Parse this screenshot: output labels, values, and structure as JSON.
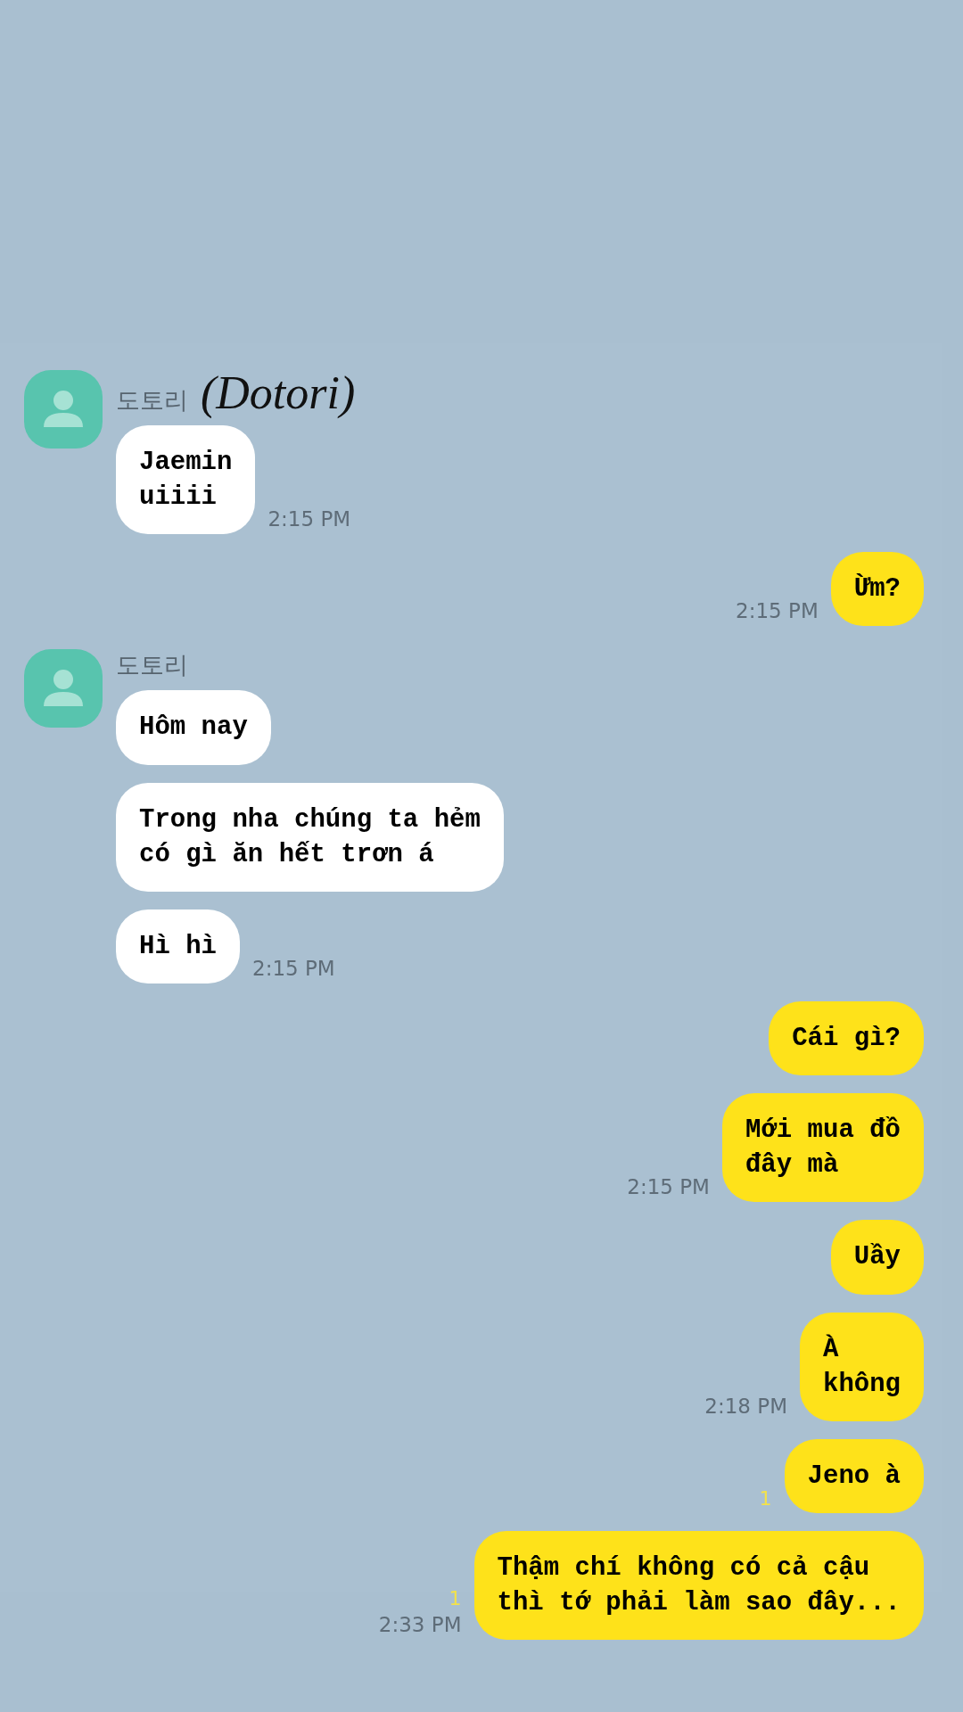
{
  "messages": [
    {
      "kind": "received",
      "sender": "도토리",
      "sender_note": "(Dotori)",
      "text": "Jaemin\nuiiii",
      "time": "2:15 PM"
    },
    {
      "kind": "sent",
      "text": "Ừm?",
      "time": "2:15 PM"
    },
    {
      "kind": "received",
      "sender": "도토리",
      "text": "Hôm nay"
    },
    {
      "kind": "received",
      "text": "Trong nha chúng ta hẻm\ncó gì ăn hết trơn á"
    },
    {
      "kind": "received",
      "text": "Hì hì",
      "time": "2:15 PM"
    },
    {
      "kind": "sent",
      "text": "Cái gì?"
    },
    {
      "kind": "sent",
      "text": "Mới mua đồ\nđây mà",
      "time": "2:15 PM"
    },
    {
      "kind": "sent",
      "text": "Uầy"
    },
    {
      "kind": "sent",
      "text": "À\nkhông",
      "time": "2:18 PM"
    },
    {
      "kind": "sent",
      "text": "Jeno à",
      "unread": "1"
    },
    {
      "kind": "sent",
      "text": "Thậm chí không có cả cậu\nthì tớ phải làm sao đây...",
      "unread": "1",
      "time": "2:33 PM"
    }
  ]
}
